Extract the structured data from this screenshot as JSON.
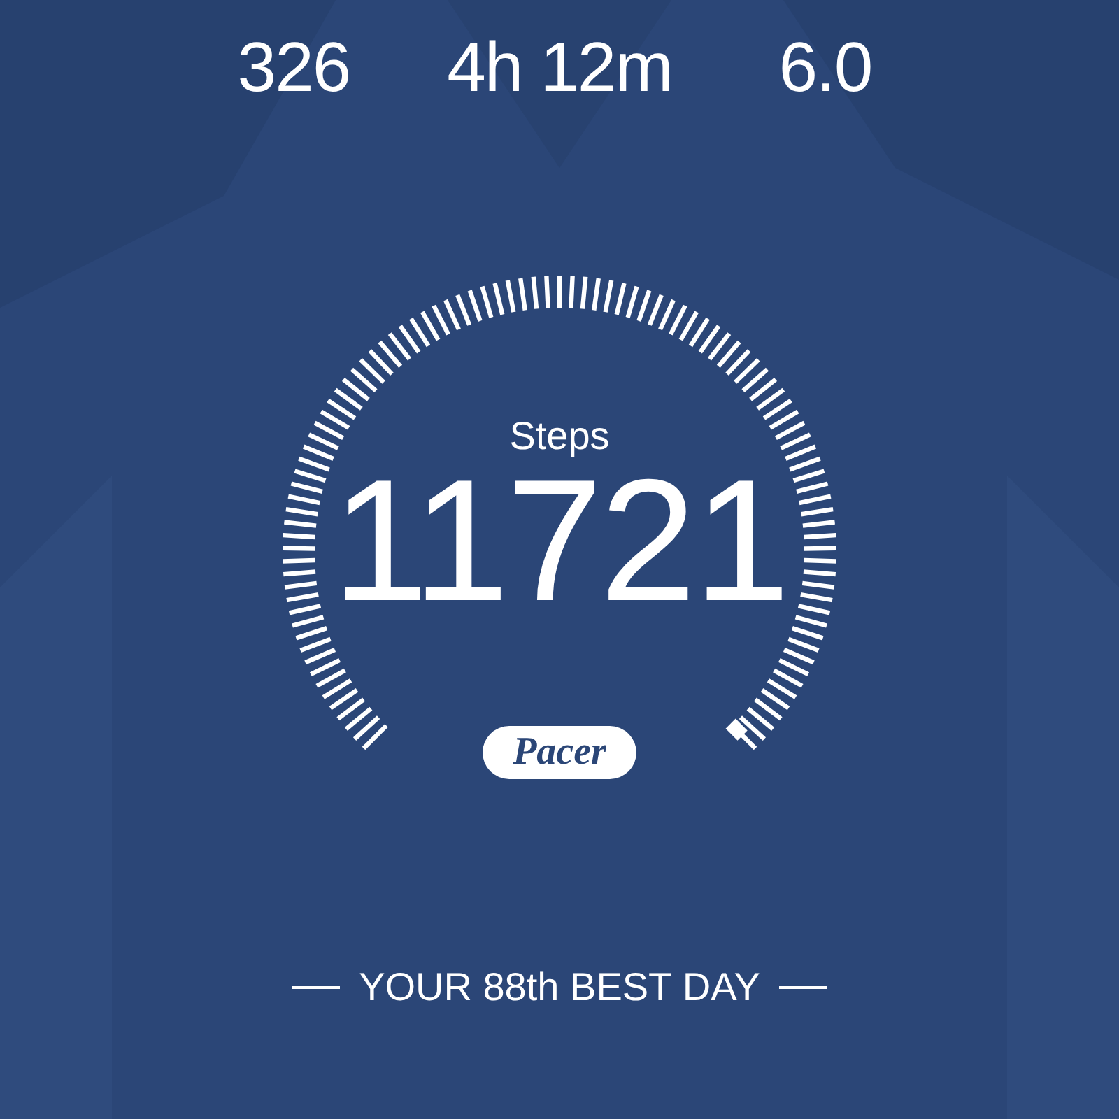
{
  "stats": [
    {
      "value": "326"
    },
    {
      "value": "4h 12m"
    },
    {
      "value": "6.0"
    }
  ],
  "gauge": {
    "label": "Steps",
    "value": "11721"
  },
  "logo": "Pacer",
  "footer": "YOUR 88th BEST DAY"
}
